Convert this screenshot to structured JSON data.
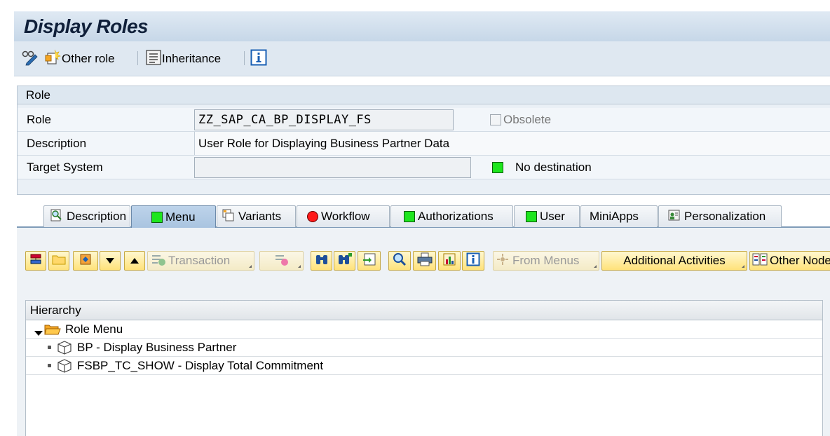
{
  "title": "Display Roles",
  "app_toolbar": {
    "other_role": "Other role",
    "inheritance": "Inheritance"
  },
  "role_panel": {
    "header": "Role",
    "role_label": "Role",
    "role_value": "ZZ_SAP_CA_BP_DISPLAY_FS",
    "obsolete_label": "Obsolete",
    "description_label": "Description",
    "description_value": "User Role for Displaying Business Partner Data",
    "target_system_label": "Target System",
    "target_system_value": "",
    "destination_status": "No destination"
  },
  "tabs": [
    {
      "label": "Description"
    },
    {
      "label": "Menu"
    },
    {
      "label": "Variants"
    },
    {
      "label": "Workflow"
    },
    {
      "label": "Authorizations"
    },
    {
      "label": "User"
    },
    {
      "label": "MiniApps"
    },
    {
      "label": "Personalization"
    }
  ],
  "menu_toolbar": {
    "transaction": "Transaction",
    "from_menus": "From Menus",
    "additional_activities": "Additional Activities",
    "other_node": "Other Node"
  },
  "hierarchy": {
    "header": "Hierarchy",
    "root": "Role Menu",
    "items": [
      {
        "label": "BP - Display Business Partner"
      },
      {
        "label": "FSBP_TC_SHOW - Display Total Commitment"
      }
    ]
  },
  "colors": {
    "status_green": "#1ee61e",
    "status_red": "#ff1a1a",
    "button_yellow": "#ffe27a",
    "active_tab": "#a9c4e0"
  }
}
